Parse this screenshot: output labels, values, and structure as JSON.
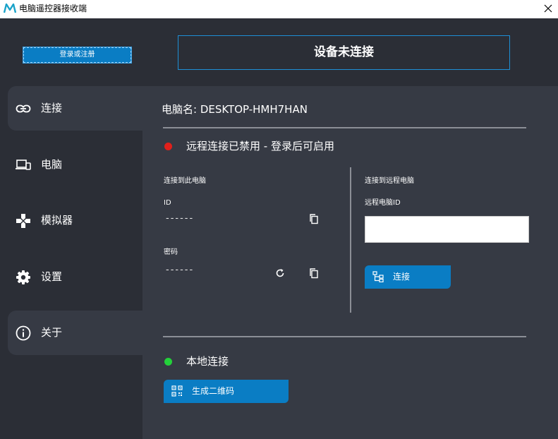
{
  "window": {
    "title": "电脑遥控器接收端",
    "app_icon": "m-logo-icon",
    "close_icon": "close-icon"
  },
  "sidebar": {
    "login_label": "登录或注册",
    "items": [
      {
        "label": "连接",
        "icon": "link-icon",
        "active": true
      },
      {
        "label": "电脑",
        "icon": "devices-icon",
        "active": false
      },
      {
        "label": "模拟器",
        "icon": "gamepad-icon",
        "active": false
      },
      {
        "label": "设置",
        "icon": "gear-icon",
        "active": false
      },
      {
        "label": "关于",
        "icon": "info-icon",
        "active": true
      }
    ]
  },
  "status_banner": "设备未连接",
  "main": {
    "pc_name": "电脑名: DESKTOP-HMH7HAN",
    "remote_status": {
      "text": "远程连接已禁用 - 登录后可启用",
      "color": "#e0201b"
    },
    "this_pc": {
      "title": "连接到此电脑",
      "id_label": "ID",
      "id_value": "------",
      "password_label": "密码",
      "password_value": "------"
    },
    "remote_pc": {
      "title": "连接到远程电脑",
      "id_label": "远程电脑ID",
      "id_value": "",
      "connect_label": "连接"
    },
    "local_status": {
      "text": "本地连接",
      "color": "#23d13a"
    },
    "qr_label": "生成二维码"
  },
  "colors": {
    "accent": "#0a7dc4",
    "background": "#2b2e36",
    "panel": "#363a44"
  }
}
